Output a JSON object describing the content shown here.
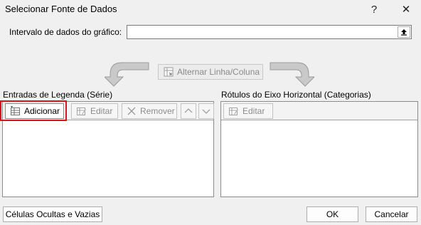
{
  "window": {
    "title": "Selecionar Fonte de Dados",
    "help_glyph": "?",
    "close_glyph": "✕"
  },
  "data_range": {
    "label": "Intervalo de dados do gráfico:",
    "value": ""
  },
  "switch_button": {
    "label": "Alternar Linha/Coluna"
  },
  "legend_entries": {
    "header": "Entradas de Legenda (Série)",
    "toolbar": {
      "add_label": "Adicionar",
      "edit_label": "Editar",
      "remove_label": "Remover"
    },
    "items": []
  },
  "axis_labels": {
    "header": "Rótulos do Eixo Horizontal (Categorias)",
    "toolbar": {
      "edit_label": "Editar"
    },
    "items": []
  },
  "footer": {
    "hidden_cells_label": "Células Ocultas e Vazias",
    "ok_label": "OK",
    "cancel_label": "Cancelar"
  },
  "colors": {
    "highlight": "#d8141c",
    "background": "#f0f0f0"
  },
  "icons": {
    "help": "question-mark-icon",
    "close": "close-icon",
    "collapse": "collapse-dialog-icon",
    "switch": "switch-row-column-icon",
    "add": "table-add-icon",
    "edit": "edit-icon",
    "remove": "remove-x-icon",
    "up": "chevron-up-icon",
    "down": "chevron-down-icon"
  }
}
